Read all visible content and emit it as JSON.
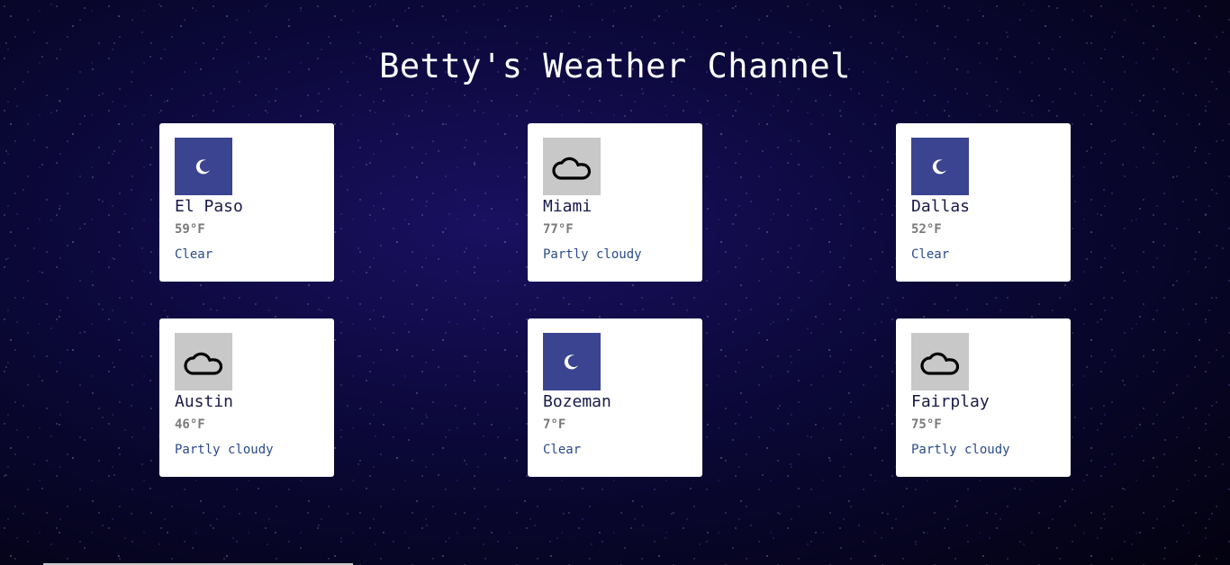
{
  "title": "Betty's Weather Channel",
  "cards": [
    {
      "city": "El Paso",
      "temp": "59°F",
      "condition": "Clear",
      "icon": "moon-icon"
    },
    {
      "city": "Miami",
      "temp": "77°F",
      "condition": "Partly cloudy",
      "icon": "cloud-icon"
    },
    {
      "city": "Dallas",
      "temp": "52°F",
      "condition": "Clear",
      "icon": "moon-icon"
    },
    {
      "city": "Austin",
      "temp": "46°F",
      "condition": "Partly cloudy",
      "icon": "cloud-icon"
    },
    {
      "city": "Bozeman",
      "temp": "7°F",
      "condition": "Clear",
      "icon": "moon-icon"
    },
    {
      "city": "Fairplay",
      "temp": "75°F",
      "condition": "Partly cloudy",
      "icon": "cloud-icon"
    }
  ],
  "colors": {
    "clear_icon_bg": "#3b4490",
    "cloudy_icon_bg": "#c8c8c8",
    "card_bg": "#ffffff",
    "condition_text": "#2a4a8a"
  }
}
